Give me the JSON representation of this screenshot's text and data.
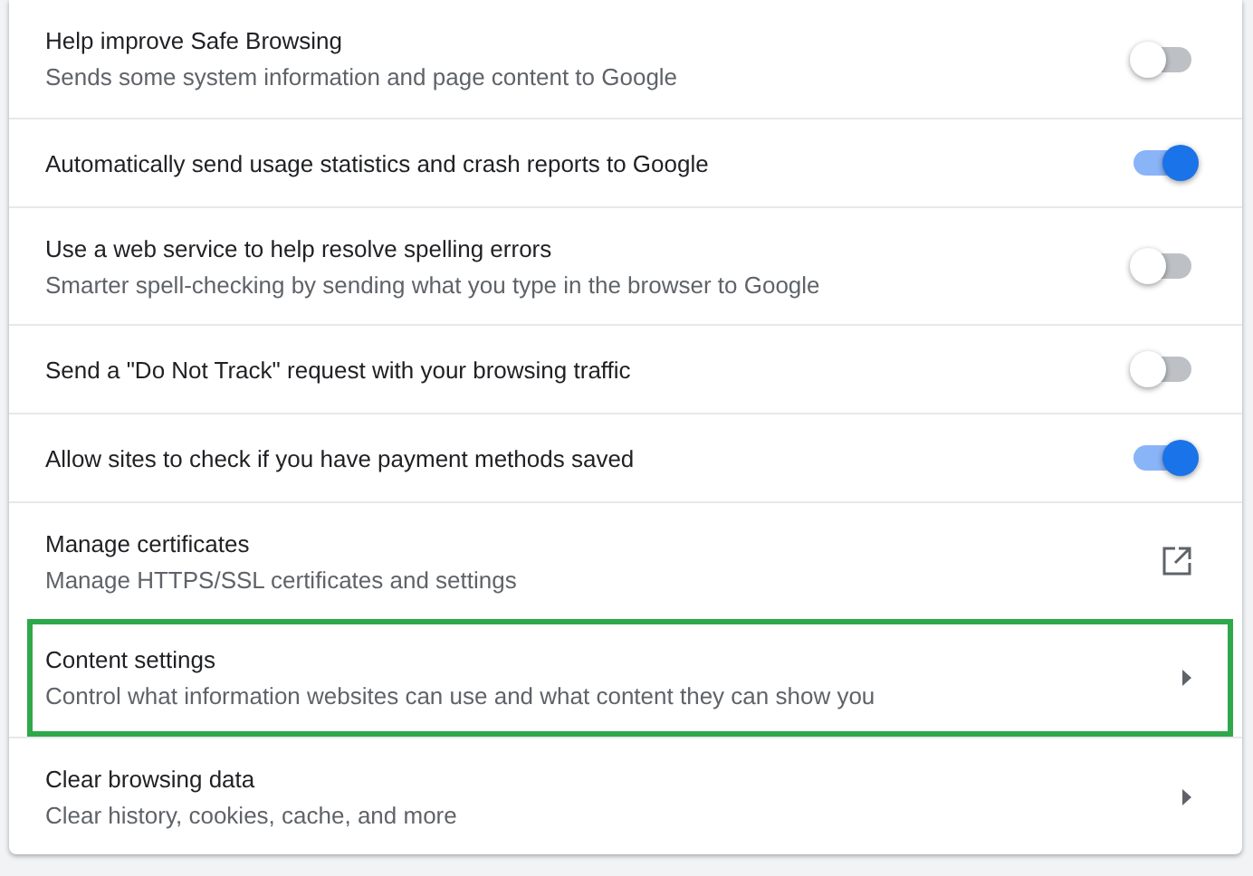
{
  "rows": [
    {
      "kind": "toggle",
      "title": "Help improve Safe Browsing",
      "subtitle": "Sends some system information and page content to Google",
      "on": false,
      "highlighted": false
    },
    {
      "kind": "toggle",
      "title": "Automatically send usage statistics and crash reports to Google",
      "on": true,
      "highlighted": false
    },
    {
      "kind": "toggle",
      "title": "Use a web service to help resolve spelling errors",
      "subtitle": "Smarter spell-checking by sending what you type in the browser to Google",
      "on": false,
      "highlighted": false
    },
    {
      "kind": "toggle",
      "title": "Send a \"Do Not Track\" request with your browsing traffic",
      "on": false,
      "highlighted": false
    },
    {
      "kind": "toggle",
      "title": "Allow sites to check if you have payment methods saved",
      "on": true,
      "highlighted": false
    },
    {
      "kind": "external",
      "title": "Manage certificates",
      "subtitle": "Manage HTTPS/SSL certificates and settings",
      "highlighted": false
    },
    {
      "kind": "submenu",
      "title": "Content settings",
      "subtitle": "Control what information websites can use and what content they can show you",
      "highlighted": true
    },
    {
      "kind": "submenu",
      "title": "Clear browsing data",
      "subtitle": "Clear history, cookies, cache, and more",
      "highlighted": false
    }
  ]
}
